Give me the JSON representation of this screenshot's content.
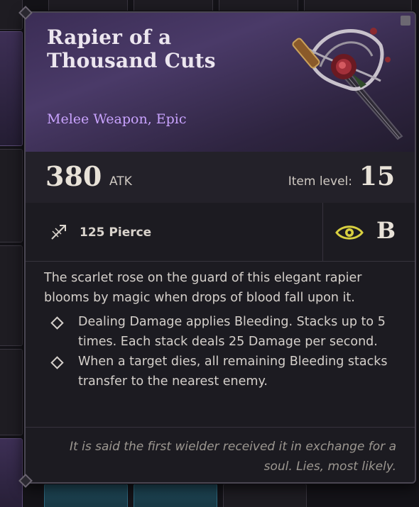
{
  "item": {
    "name": "Rapier of a Thousand Cuts",
    "type": "Melee Weapon, Epic",
    "atk_value": "380",
    "atk_unit": "ATK",
    "item_level_label": "Item level:",
    "item_level_value": "15",
    "attribute_icon": "pierce-icon",
    "attribute_text": "125 Pierce",
    "grade_icon": "eye-icon",
    "grade": "B",
    "description": "The scarlet rose on the guard of this elegant rapier blooms by magic when drops of blood fall upon it.",
    "effects": [
      "Dealing Damage applies Bleeding. Stacks up to 5 times. Each stack deals 25 Damage per second.",
      "When a target dies, all remaining Bleeding stacks transfer to the nearest enemy."
    ],
    "lore": "It is said the first wielder received it in exchange for a soul. Lies, most likely."
  },
  "colors": {
    "rarity_epic": "#c9a3ff",
    "header_bg": "#3b2d55",
    "grade_eye": "#d8d040"
  }
}
